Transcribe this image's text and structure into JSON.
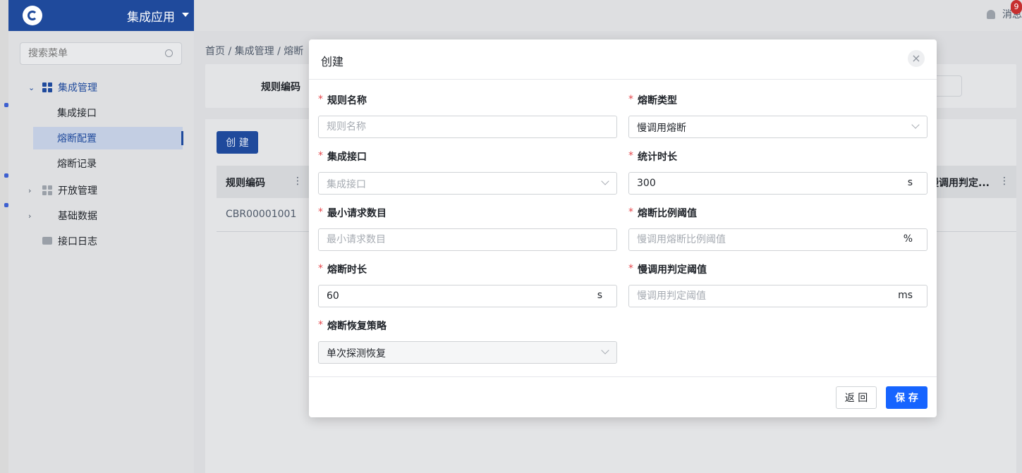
{
  "header": {
    "app_name": "集成应用",
    "message_label": "消息",
    "message_count": "9"
  },
  "sidebar": {
    "search_placeholder": "搜索菜单",
    "items": [
      {
        "label": "集成管理"
      },
      {
        "label": "集成接口"
      },
      {
        "label": "熔断配置"
      },
      {
        "label": "熔断记录"
      },
      {
        "label": "开放管理"
      },
      {
        "label": "基础数据"
      },
      {
        "label": "接口日志"
      }
    ]
  },
  "main": {
    "breadcrumb": "首页 / 集成管理 / 熔断",
    "filter_label": "规则编码",
    "create_button": "创 建",
    "table": {
      "col_first": "规则编码",
      "col_slow": "慢调用判定...",
      "col_dots": "⋮",
      "row1_code": "CBR00001001"
    }
  },
  "modal": {
    "title": "创建",
    "close_icon": "×",
    "fields": {
      "rule_name": {
        "label": "规则名称",
        "placeholder": "规则名称"
      },
      "breaker_type": {
        "label": "熔断类型",
        "value": "慢调用熔断"
      },
      "interface": {
        "label": "集成接口",
        "placeholder": "集成接口"
      },
      "stat_duration": {
        "label": "统计时长",
        "value": "300",
        "unit": "s"
      },
      "min_requests": {
        "label": "最小请求数目",
        "placeholder": "最小请求数目"
      },
      "ratio_threshold": {
        "label": "熔断比例阈值",
        "placeholder": "慢调用熔断比例阈值",
        "unit": "%"
      },
      "break_duration": {
        "label": "熔断时长",
        "value": "60",
        "unit": "s"
      },
      "slow_threshold": {
        "label": "慢调用判定阈值",
        "placeholder": "慢调用判定阈值",
        "unit": "ms"
      },
      "recovery": {
        "label": "熔断恢复策略",
        "value": "单次探测恢复"
      }
    },
    "required_mark": "*",
    "back_button": "返 回",
    "save_button": "保 存"
  },
  "colors": {
    "primary": "#1664ff",
    "brand_dark": "#1f4a9c",
    "required": "#e5484d"
  }
}
